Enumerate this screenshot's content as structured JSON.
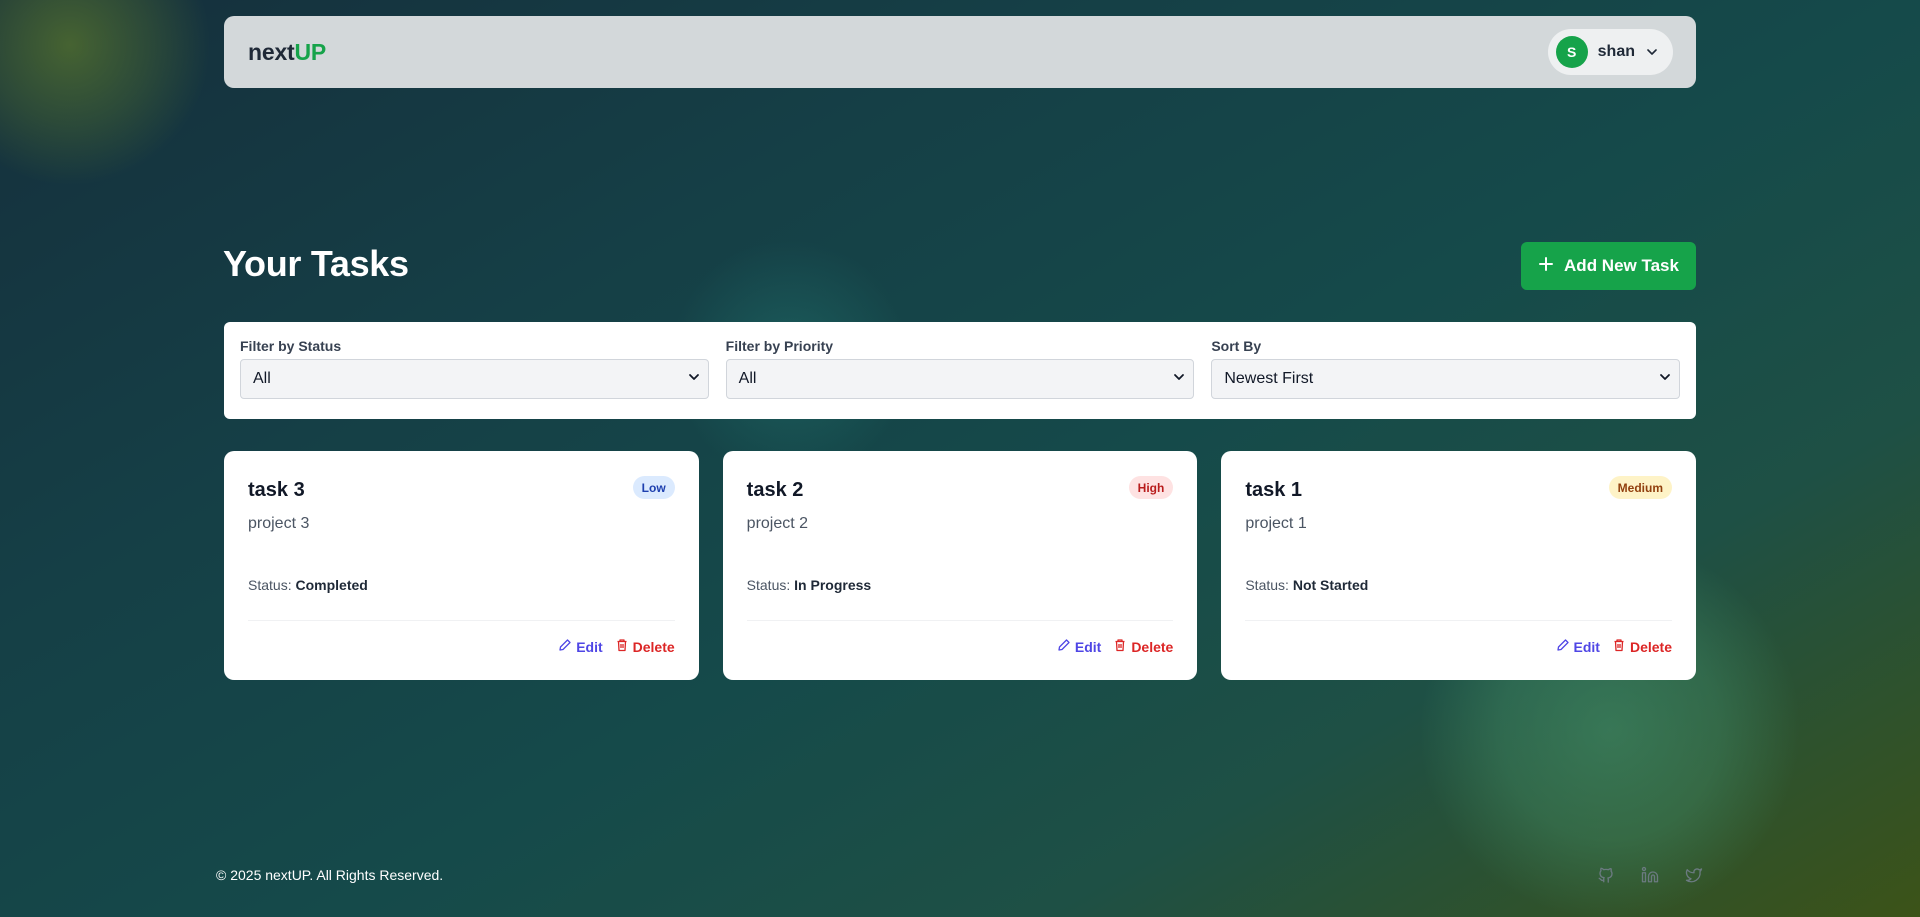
{
  "header": {
    "logo_prefix": "next",
    "logo_accent": "UP",
    "user_initial": "S",
    "user_name": "shan"
  },
  "main": {
    "title": "Your Tasks",
    "add_button_label": "Add New Task"
  },
  "filters": [
    {
      "label": "Filter by Status",
      "value": "All"
    },
    {
      "label": "Filter by Priority",
      "value": "All"
    },
    {
      "label": "Sort By",
      "value": "Newest First"
    }
  ],
  "tasks": [
    {
      "title": "task 3",
      "project": "project 3",
      "priority": "Low",
      "status_label": "Status:",
      "status": "Completed",
      "edit_label": "Edit",
      "delete_label": "Delete"
    },
    {
      "title": "task 2",
      "project": "project 2",
      "priority": "High",
      "status_label": "Status:",
      "status": "In Progress",
      "edit_label": "Edit",
      "delete_label": "Delete"
    },
    {
      "title": "task 1",
      "project": "project 1",
      "priority": "Medium",
      "status_label": "Status:",
      "status": "Not Started",
      "edit_label": "Edit",
      "delete_label": "Delete"
    }
  ],
  "footer": {
    "copyright": "© 2025 nextUP. All Rights Reserved.",
    "social_icons": [
      "github-icon",
      "linkedin-icon",
      "twitter-icon"
    ]
  },
  "colors": {
    "accent": "#16a34a",
    "edit": "#4f46e5",
    "delete": "#dc2626",
    "priority_low": "#dbeafe",
    "priority_high": "#fee2e2",
    "priority_medium": "#fef3c7"
  }
}
